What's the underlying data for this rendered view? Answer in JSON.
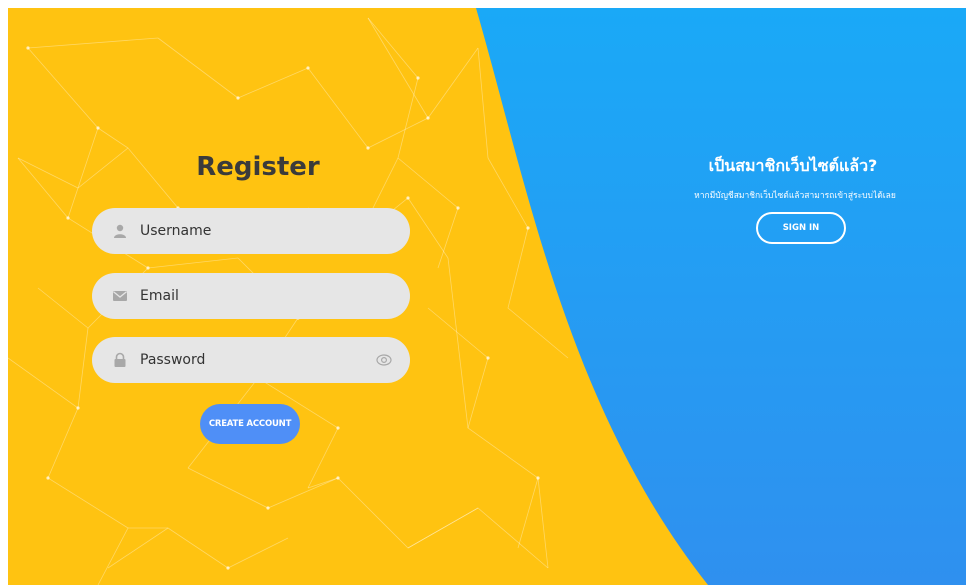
{
  "register": {
    "title": "Register",
    "username_placeholder": "Username",
    "email_placeholder": "Email",
    "password_placeholder": "Password",
    "create_label": "CREATE ACCOUNT"
  },
  "signin_panel": {
    "title": "เป็นสมาชิกเว็บไซต์แล้ว?",
    "subtitle": "หากมีบัญชีสมาชิกเว็บไซต์แล้วสามารถเข้าสู่ระบบได้เลย",
    "button_label": "SIGN IN"
  },
  "icons": {
    "username": "user-icon",
    "email": "envelope-icon",
    "password": "lock-icon",
    "toggle": "eye-icon"
  },
  "colors": {
    "left_bg": "#ffc311",
    "right_bg_top": "#1aa9f7",
    "right_bg_bottom": "#2f90ef",
    "accent_button": "#4f8ff7",
    "field_bg": "#e6e6e6",
    "title_text": "#3b3b3b"
  }
}
